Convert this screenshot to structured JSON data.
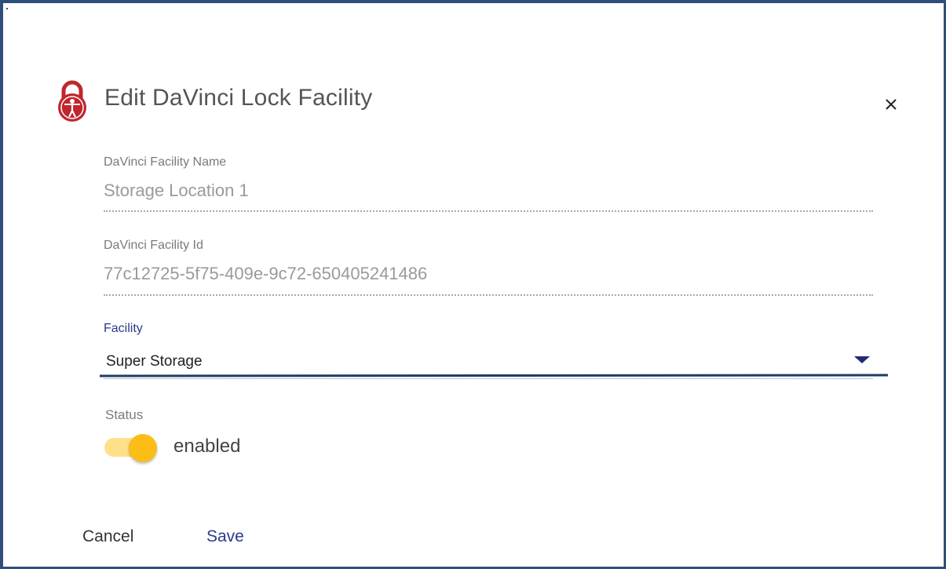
{
  "dialog": {
    "title": "Edit DaVinci Lock Facility",
    "close_glyph": "×",
    "icon": "lock-icon"
  },
  "fields": {
    "facility_name": {
      "label": "DaVinci Facility Name",
      "value": "Storage Location 1"
    },
    "facility_id": {
      "label": "DaVinci Facility Id",
      "value": "77c12725-5f75-409e-9c72-650405241486"
    },
    "facility": {
      "label": "Facility",
      "selected": "Super Storage"
    },
    "status": {
      "label": "Status",
      "toggle_text": "enabled",
      "enabled": true
    }
  },
  "actions": {
    "cancel_label": "Cancel",
    "save_label": "Save"
  },
  "colors": {
    "frame_border": "#2f4f7a",
    "icon_red": "#c0262d",
    "accent_blue": "#2b3a8a",
    "toggle_thumb": "#fcbd16",
    "toggle_track": "#ffe08a"
  }
}
